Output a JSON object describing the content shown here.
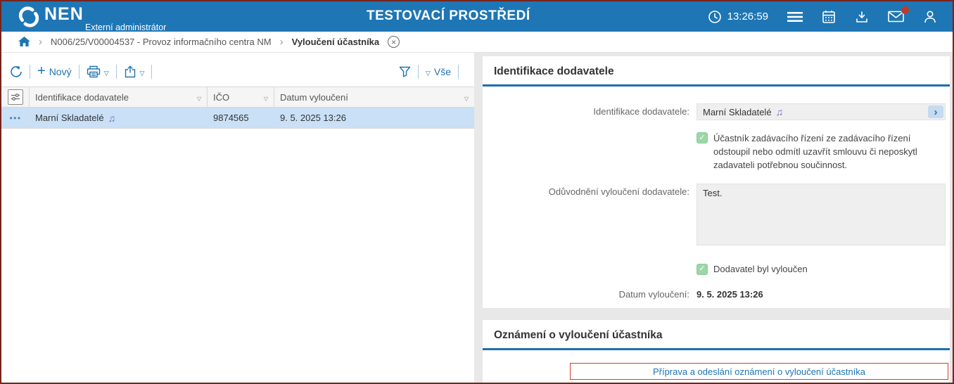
{
  "header": {
    "logo": "NEN",
    "role": "Externí administrátor",
    "environment": "TESTOVACÍ PROSTŘEDÍ",
    "time": "13:26:59"
  },
  "breadcrumb": {
    "procedure": "N006/25/V00004537 - Provoz informačního centra NM",
    "current": "Vyloučení účastníka"
  },
  "toolbar": {
    "new_label": "Nový",
    "filter_all_label": "Vše"
  },
  "table": {
    "columns": {
      "supplier": "Identifikace dodavatele",
      "ico": "IČO",
      "date": "Datum vyloučení"
    },
    "rows": [
      {
        "supplier": "Marní Skladatelé",
        "ico": "9874565",
        "date": "9. 5. 2025 13:26"
      }
    ]
  },
  "detail": {
    "identification": {
      "title": "Identifikace dodavatele",
      "supplier_label": "Identifikace dodavatele:",
      "supplier_value": "Marní Skladatelé",
      "withdrawal_checkbox_label": "Účastník zadávacího řízení ze zadávacího řízení odstoupil nebo odmítl uzavřít smlouvu či neposkytl zadavateli potřebnou součinnost.",
      "withdrawal_checked": true,
      "justification_label": "Odůvodnění vyloučení dodavatele:",
      "justification_value": "Test.",
      "excluded_checkbox_label": "Dodavatel byl vyloučen",
      "excluded_checked": true,
      "date_label": "Datum vyloučení:",
      "date_value": "9. 5. 2025 13:26"
    },
    "notification": {
      "title": "Oznámení o vyloučení účastníka",
      "action_button_label": "Příprava a odeslání oznámení o vyloučení účastníka"
    }
  },
  "colors": {
    "header_blue": "#1e76b5",
    "accent_blue": "#1e74b2",
    "section_underline_blue": "#1c70b0",
    "selected_row_blue": "#c9e0f7",
    "checkbox_green": "#9dd6a8",
    "action_border_red": "#d93b31",
    "notification_dot_red": "#c0392b",
    "music_note_purple": "#7c6bb8",
    "window_border_maroon": "#76241c"
  }
}
